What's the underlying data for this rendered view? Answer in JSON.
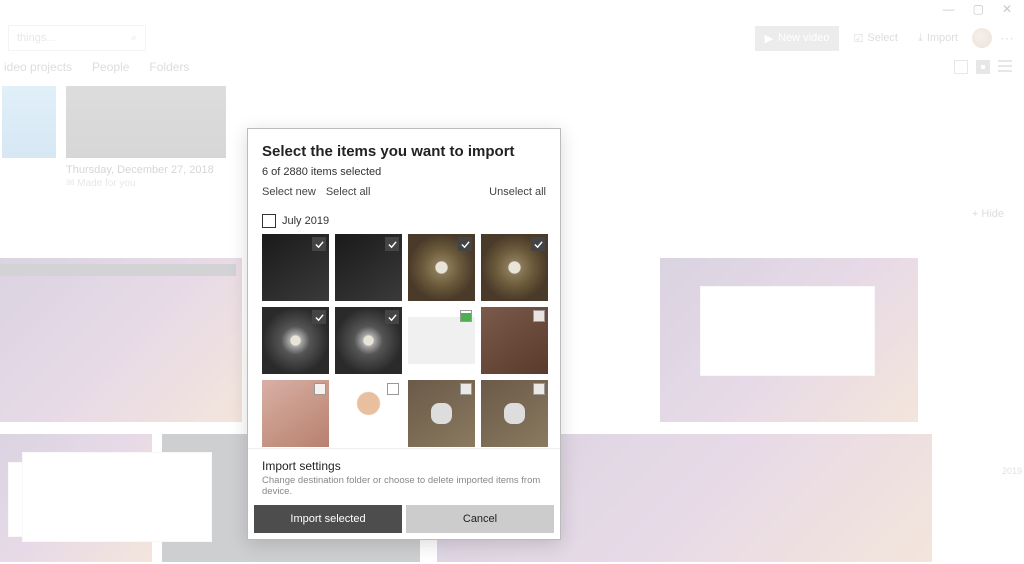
{
  "title_bar": {
    "min": "—",
    "max": "▢",
    "close": "✕"
  },
  "toolbar": {
    "search_placeholder": "things...",
    "new_video": "New video",
    "select": "Select",
    "import": "Import"
  },
  "nav": {
    "items": [
      "ideo projects",
      "People",
      "Folders"
    ]
  },
  "hide": "Hide",
  "album": {
    "date": "Thursday, December 27, 2018",
    "made": "Made for you"
  },
  "timeline_year": "2019",
  "dialog": {
    "title": "Select the items you want to import",
    "count": "6 of 2880 items selected",
    "select_new": "Select new",
    "select_all": "Select all",
    "unselect_all": "Unselect all",
    "group": "July 2019",
    "settings_title": "Import settings",
    "settings_sub": "Change destination folder or choose to delete imported items from device.",
    "btn_import": "Import selected",
    "btn_cancel": "Cancel",
    "items": [
      {
        "c": "ph-dark",
        "sel": true
      },
      {
        "c": "ph-dark",
        "sel": true
      },
      {
        "c": "ph-ring",
        "sel": true
      },
      {
        "c": "ph-ring",
        "sel": true
      },
      {
        "c": "ph-ring2",
        "sel": true
      },
      {
        "c": "ph-ring2",
        "sel": true
      },
      {
        "c": "ph-ui",
        "sel": false
      },
      {
        "c": "ph-plush",
        "sel": false
      },
      {
        "c": "ph-pink",
        "sel": false
      },
      {
        "c": "ph-whiteface",
        "sel": false
      },
      {
        "c": "ph-floor",
        "sel": false
      },
      {
        "c": "ph-floor",
        "sel": false
      },
      {
        "c": "ph-pink",
        "sel": false
      },
      {
        "c": "ph-pink",
        "sel": false
      },
      {
        "c": "ph-pink",
        "sel": false
      },
      {
        "c": "ph-pink",
        "sel": false
      }
    ]
  }
}
